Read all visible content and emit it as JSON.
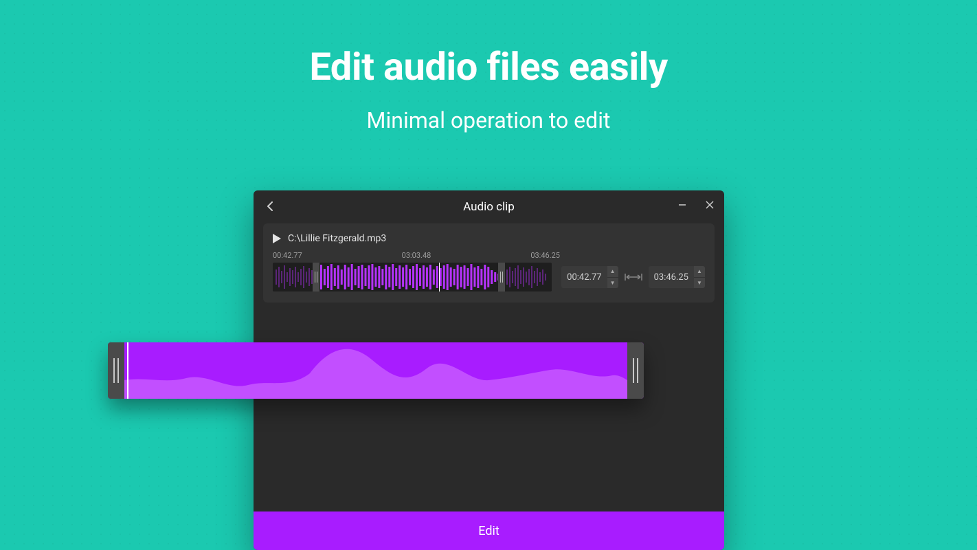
{
  "hero": {
    "title": "Edit audio files easily",
    "subtitle": "Minimal operation to edit"
  },
  "window": {
    "title": "Audio clip",
    "file_path": "C:\\Lillie Fitzgerald.mp3",
    "time_labels": {
      "start": "00:42.77",
      "mid": "03:03.48",
      "end": "03:46.25"
    },
    "time_inputs": {
      "start": "00:42.77",
      "end": "03:46.25"
    },
    "edit_button": "Edit"
  },
  "colors": {
    "background": "#1bc9b0",
    "app_bg": "#2a2a2a",
    "panel_bg": "#333333",
    "accent": "#a81cff",
    "wave_seg": "#b633ff"
  }
}
